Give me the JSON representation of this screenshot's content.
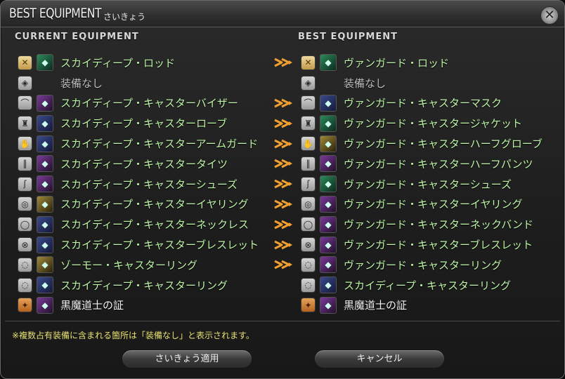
{
  "window": {
    "title": "BEST EQUIPMENT",
    "subtitle": "さいきょう"
  },
  "headers": {
    "current": "CURRENT EQUIPMENT",
    "best": "BEST EQUIPMENT"
  },
  "rows": [
    {
      "slot_icon": "weapon-icon",
      "current": "スカイディープ・ロッド",
      "best": "ヴァンガード・ロッド",
      "changed": true
    },
    {
      "slot_icon": "shield-icon",
      "current": "装備なし",
      "best": "装備なし",
      "changed": false
    },
    {
      "slot_icon": "head-icon",
      "current": "スカイディープ・キャスターバイザー",
      "best": "ヴァンガード・キャスターマスク",
      "changed": true
    },
    {
      "slot_icon": "body-icon",
      "current": "スカイディープ・キャスターローブ",
      "best": "ヴァンガード・キャスタージャケット",
      "changed": true
    },
    {
      "slot_icon": "hands-icon",
      "current": "スカイディープ・キャスターアームガード",
      "best": "ヴァンガード・キャスターハーフグローブ",
      "changed": true
    },
    {
      "slot_icon": "legs-icon",
      "current": "スカイディープ・キャスタータイツ",
      "best": "ヴァンガード・キャスターハーフパンツ",
      "changed": true
    },
    {
      "slot_icon": "feet-icon",
      "current": "スカイディープ・キャスターシューズ",
      "best": "ヴァンガード・キャスターシューズ",
      "changed": true
    },
    {
      "slot_icon": "earring-icon",
      "current": "スカイディープ・キャスターイヤリング",
      "best": "ヴァンガード・キャスターイヤリング",
      "changed": true
    },
    {
      "slot_icon": "necklace-icon",
      "current": "スカイディープ・キャスターネックレス",
      "best": "ヴァンガード・キャスターネックバンド",
      "changed": true
    },
    {
      "slot_icon": "bracelet-icon",
      "current": "スカイディープ・キャスターブレスレット",
      "best": "ヴァンガード・キャスターブレスレット",
      "changed": true
    },
    {
      "slot_icon": "ring-icon",
      "current": "ゾーモー・キャスターリング",
      "best": "ヴァンガード・キャスターリング",
      "changed": true
    },
    {
      "slot_icon": "ring-icon",
      "current": "スカイディープ・キャスターリング",
      "best": "スカイディープ・キャスターリング",
      "changed": false
    },
    {
      "slot_icon": "soul-crystal-icon",
      "current": "黒魔道士の証",
      "best": "黒魔道士の証",
      "changed": false
    }
  ],
  "notice": "※複数占有装備に含まれる箇所は「装備なし」と表示されます。",
  "buttons": {
    "apply": "さいきょう適用",
    "cancel": "キャンセル"
  },
  "colors": {
    "item_name": "#bdf4a6",
    "empty_name": "#bdbdbd",
    "notice": "#e8e070",
    "arrow": "#f0a030"
  }
}
